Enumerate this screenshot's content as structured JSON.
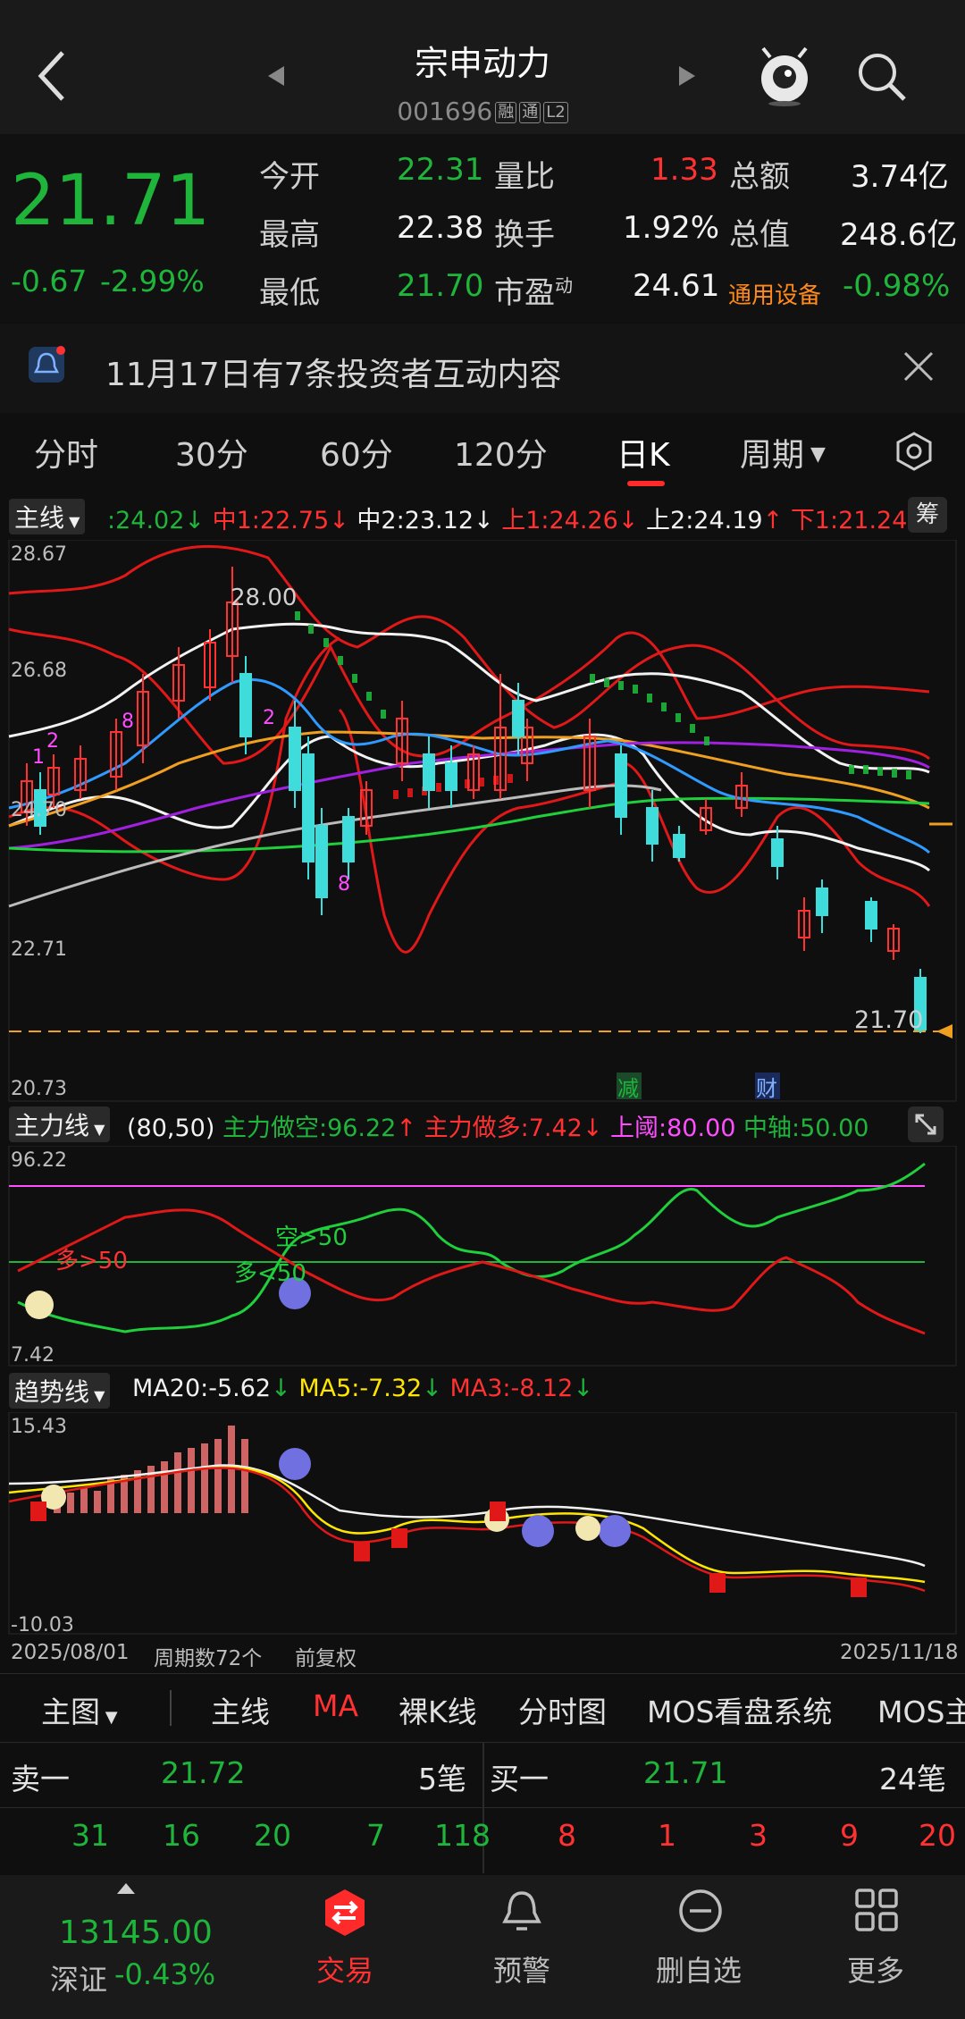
{
  "header": {
    "title": "宗申动力",
    "code": "001696",
    "tags": [
      "融",
      "通",
      "L2"
    ]
  },
  "quote": {
    "price": "21.71",
    "change": "-0.67",
    "change_pct": "-2.99%",
    "rows": [
      [
        {
          "label": "今开",
          "value": "22.31"
        },
        {
          "label": "量比",
          "value": "1.33"
        },
        {
          "label": "总额",
          "value": "3.74亿"
        }
      ],
      [
        {
          "label": "最高",
          "value": "22.38"
        },
        {
          "label": "换手",
          "value": "1.92%"
        },
        {
          "label": "总值",
          "value": "248.6亿"
        }
      ],
      [
        {
          "label": "最低",
          "value": "21.70"
        },
        {
          "label": "市盈",
          "label_sup": "动",
          "value": "24.61"
        },
        {
          "label": "通用设备",
          "value": "-0.98%"
        }
      ]
    ]
  },
  "notice": {
    "text": "11月17日有7条投资者互动内容"
  },
  "period_tabs": [
    "分时",
    "30分",
    "60分",
    "120分",
    "日K",
    "周期"
  ],
  "main_chart": {
    "label": "主线",
    "legend": [
      {
        "text": ":24.02",
        "arrow": "↓",
        "color": "#1fb53b"
      },
      {
        "text": "中1:22.75",
        "arrow": "↓",
        "color": "#ff3131"
      },
      {
        "text": "中2:23.12",
        "arrow": "↓",
        "color": "#f2f2f2"
      },
      {
        "text": "上1:24.26",
        "arrow": "↓",
        "color": "#ff3131"
      },
      {
        "text": "上2:24.19",
        "arrow": "↑",
        "color": "#f2f2f2"
      },
      {
        "text": "下1:21.24",
        "arrow": "↓",
        "color": "#ff3131"
      }
    ],
    "side_button": "筹",
    "y_ticks": [
      "28.67",
      "26.68",
      "24.70",
      "22.71",
      "20.73"
    ],
    "high_label": "28.00",
    "last_label": "21.70",
    "markers": [
      "减",
      "财"
    ]
  },
  "sub1": {
    "label": "主力线",
    "params": "(80,50)",
    "legend": [
      {
        "text": "主力做空:96.22",
        "arrow": "↑",
        "color": "#1fb53b"
      },
      {
        "text": "主力做多:7.42",
        "arrow": "↓",
        "color": "#ff3131"
      },
      {
        "text": "上阈:80.00",
        "arrow": "",
        "color": "#ff4dff"
      },
      {
        "text": "中轴:50.00",
        "arrow": "",
        "color": "#1fb53b"
      }
    ],
    "y_ticks": [
      "96.22",
      "7.42"
    ],
    "annotations": [
      "多>50",
      "空>50",
      "多<50"
    ]
  },
  "sub2": {
    "label": "趋势线",
    "legend": [
      {
        "text": "MA20:-5.62",
        "arrow": "↓",
        "color": "#f2f2f2"
      },
      {
        "text": "MA5:-7.32",
        "arrow": "↓",
        "color": "#ffe600"
      },
      {
        "text": "MA3:-8.12",
        "arrow": "↓",
        "color": "#ff3131"
      }
    ],
    "y_ticks": [
      "15.43",
      "-10.03"
    ]
  },
  "footer_axis": {
    "start": "2025/08/01",
    "count": "周期数72个",
    "adjust": "前复权",
    "end": "2025/11/18"
  },
  "main_tabs": [
    "主图",
    "主线",
    "MA",
    "裸K线",
    "分时图",
    "MOS看盘系统",
    "MOS主"
  ],
  "orderbook": {
    "sell": {
      "label": "卖一",
      "price": "21.72",
      "count": "5笔",
      "queue": [
        "31",
        "16",
        "20",
        "7",
        "118"
      ]
    },
    "buy": {
      "label": "买一",
      "price": "21.71",
      "count": "24笔",
      "queue": [
        "8",
        "1",
        "3",
        "9",
        "20"
      ]
    }
  },
  "bottom_nav": {
    "index_value": "13145.00",
    "index_name": "深证",
    "index_change": "-0.43%",
    "items": [
      "交易",
      "预警",
      "删自选",
      "更多"
    ]
  },
  "colors": {
    "up": "#ff3131",
    "down": "#1fb53b",
    "accent": "#ff8a1c",
    "bg": "#0f0f10"
  }
}
